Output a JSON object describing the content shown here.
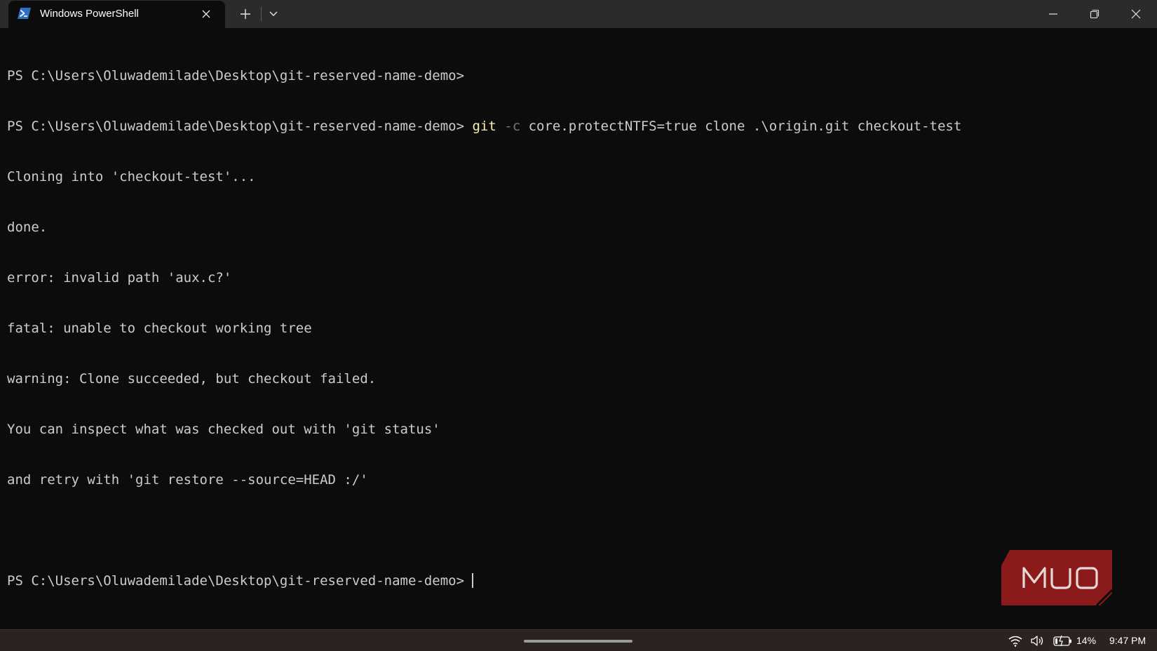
{
  "window": {
    "tab_title": "Windows PowerShell",
    "tab_icon": "powershell-icon",
    "new_tab_icon": "plus-icon",
    "dropdown_icon": "chevron-down-icon",
    "controls": [
      "minimize-icon",
      "restore-icon",
      "close-icon"
    ]
  },
  "terminal": {
    "lines": [
      "PS C:\\Users\\Oluwademilade\\Desktop\\git-reserved-name-demo>",
      "PS C:\\Users\\Oluwademilade\\Desktop\\git-reserved-name-demo> ",
      "Cloning into 'checkout-test'...",
      "done.",
      "error: invalid path 'aux.c?'",
      "fatal: unable to checkout working tree",
      "warning: Clone succeeded, but checkout failed.",
      "You can inspect what was checked out with 'git status'",
      "and retry with 'git restore --source=HEAD :/'",
      "",
      "PS C:\\Users\\Oluwademilade\\Desktop\\git-reserved-name-demo>"
    ],
    "command": {
      "program": "git",
      "flag": "-c",
      "args": " core.protectNTFS=true clone .\\origin.git checkout-test"
    }
  },
  "watermark": {
    "text": "MUO",
    "color": "#8b1a1a"
  },
  "taskbar": {
    "battery": "14%",
    "clock": "9:47 PM",
    "icons": [
      "wifi-icon",
      "volume-icon",
      "battery-charging-icon"
    ]
  },
  "colors": {
    "terminal_bg": "#0c0c0c",
    "terminal_fg": "#cccccc",
    "command_program": "#f9f1a5",
    "command_flag": "#767676",
    "titlebar_bg": "#2b2b2b",
    "taskbar_bg": "#2a231f"
  }
}
